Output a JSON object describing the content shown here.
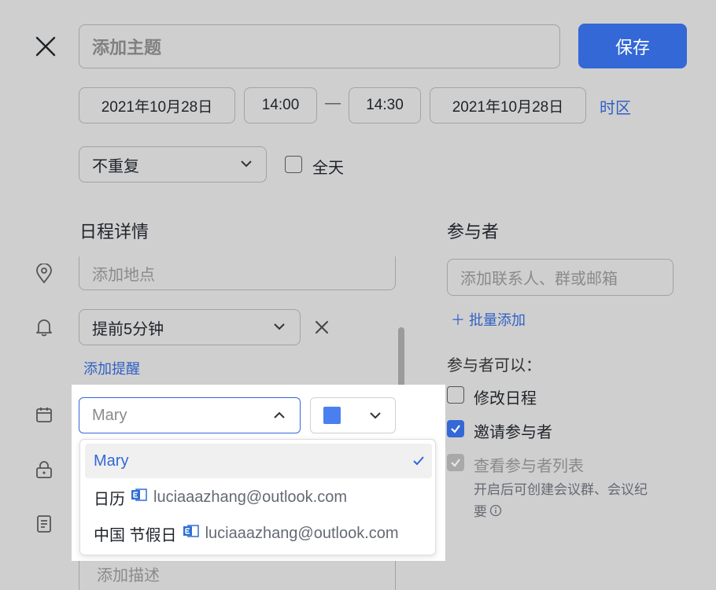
{
  "header": {
    "subject_placeholder": "添加主题",
    "save_label": "保存"
  },
  "datetime": {
    "start_date": "2021年10月28日",
    "start_time": "14:00",
    "separator": "—",
    "end_time": "14:30",
    "end_date": "2021年10月28日",
    "timezone_label": "时区"
  },
  "repeat": {
    "value": "不重复",
    "allday_label": "全天"
  },
  "details": {
    "title": "日程详情",
    "location_placeholder": "添加地点",
    "reminder_value": "提前5分钟",
    "add_reminder_label": "添加提醒",
    "calendar_value": "Mary",
    "description_placeholder": "添加描述"
  },
  "calendar_dropdown": {
    "options": [
      {
        "label": "Mary",
        "selected": true
      },
      {
        "label": "日历",
        "email": "luciaaazhang@outlook.com"
      },
      {
        "label": "中国 节假日",
        "email": "luciaaazhang@outlook.com"
      }
    ]
  },
  "attendees": {
    "title": "参与者",
    "input_placeholder": "添加联系人、群或邮箱",
    "bulk_add_label": "＋ 批量添加",
    "permissions_title": "参与者可以：",
    "perm_edit": "修改日程",
    "perm_invite": "邀请参与者",
    "perm_view": "查看参与者列表",
    "perm_view_note_line1": "开启后可创建会议群、会议纪",
    "perm_view_note_line2": "要"
  },
  "colors": {
    "accent": "#3368d6",
    "calendar_color": "#4a7ff0",
    "overlay_bg": "#cfcfcf"
  }
}
